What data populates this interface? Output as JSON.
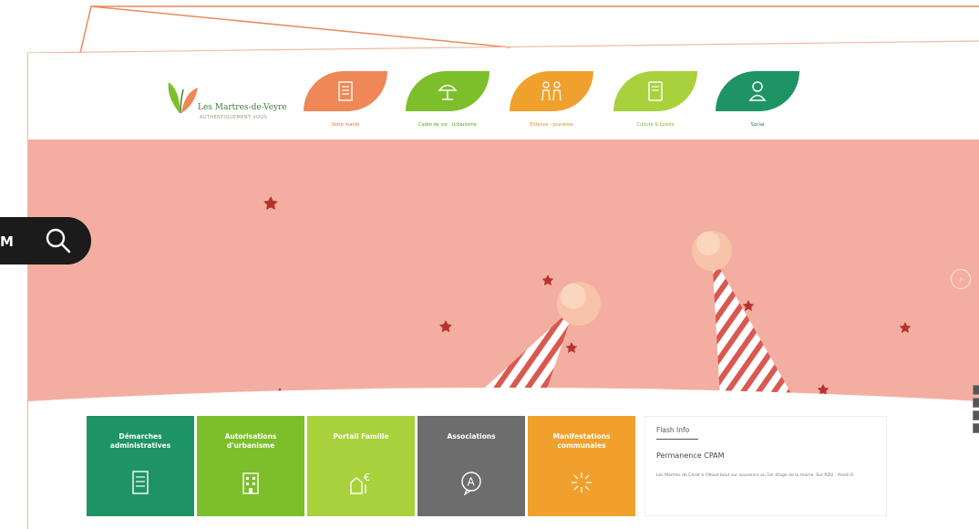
{
  "site": {
    "logo_title": "Les Martres-de-Veyre",
    "logo_tagline": "AUTHENTIQUEMENT VOUS"
  },
  "nav": [
    {
      "label": "Votre mairie",
      "icon": "building-document-icon",
      "bg": "#ef8757",
      "fg": "#e4733f"
    },
    {
      "label": "Cadre de vie - Urbanisme",
      "icon": "parasol-icon",
      "bg": "#7cbf2b",
      "fg": "#5e9f1d"
    },
    {
      "label": "Enfance - Jeunesse",
      "icon": "children-icon",
      "bg": "#f0a12d",
      "fg": "#e08a1a"
    },
    {
      "label": "Culture & Loisirs",
      "icon": "book-icon",
      "bg": "#a8d13c",
      "fg": "#7db61f"
    },
    {
      "label": "Social",
      "icon": "person-icon",
      "bg": "#1e9464",
      "fg": "#1a7f57"
    }
  ],
  "hero": {
    "background": "#f4aea1",
    "next_label": "›"
  },
  "tiles": [
    {
      "label": "Démarches administratives",
      "icon": "form-document-icon",
      "bg": "#1e9464"
    },
    {
      "label": "Autorisations d'urbanisme",
      "icon": "urban-building-icon",
      "bg": "#7cbf2b"
    },
    {
      "label": "Portail Famille",
      "icon": "family-euro-icon",
      "bg": "#a8d13c"
    },
    {
      "label": "Associations",
      "icon": "association-badge-icon",
      "bg": "#6d6d6d"
    },
    {
      "label": "Manifestations communales",
      "icon": "fireworks-icon",
      "bg": "#f0a12d"
    }
  ],
  "flash": {
    "title": "Flash Info",
    "headline": "Permanence CPAM",
    "body": "Les Martres de Cérat à l'Atout bout sur souvenirs ou 1er étage de la mairie. Sur RDV : Ameli.fr"
  },
  "search": {
    "text": "M",
    "icon": "search-icon"
  }
}
